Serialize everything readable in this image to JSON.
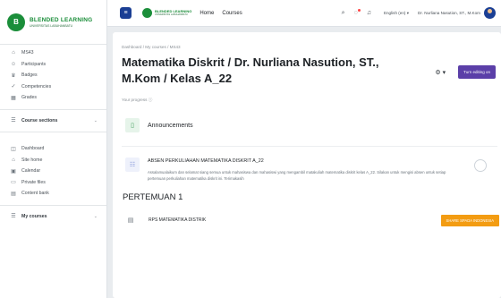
{
  "brand": {
    "logo_letter": "B",
    "name": "BLENDED LEARNING",
    "subtitle": "UNIVERSITAS LABUHANBATU"
  },
  "sidebar": {
    "items": [
      {
        "label": "MS43",
        "icon": "cap"
      },
      {
        "label": "Participants",
        "icon": "people"
      },
      {
        "label": "Badges",
        "icon": "badge"
      },
      {
        "label": "Competencies",
        "icon": "check"
      },
      {
        "label": "Grades",
        "icon": "table"
      }
    ],
    "course_sections": {
      "label": "Course sections",
      "icon": "list"
    },
    "links": [
      {
        "label": "Dashboard",
        "icon": "gauge"
      },
      {
        "label": "Site home",
        "icon": "home"
      },
      {
        "label": "Calendar",
        "icon": "calendar"
      },
      {
        "label": "Private files",
        "icon": "file"
      },
      {
        "label": "Content bank",
        "icon": "box"
      }
    ],
    "my_courses": {
      "label": "My courses",
      "icon": "cap"
    }
  },
  "topbar": {
    "menu_glyph": "≡",
    "logo_name": "BLENDED LEARNING",
    "logo_sub": "UNIVERSITAS LABUHANBATU",
    "links": [
      "Home",
      "Courses"
    ],
    "language": "English (en) ▾",
    "user_name": "Dr. Nurliana Nasution, ST., M.Kom"
  },
  "main": {
    "breadcrumb": "Dashboard  /  My courses  /  MS43",
    "title": "Matematika Diskrit / Dr. Nurliana Nasution, ST., M.Kom / Kelas A_22",
    "turn_editing_label": "Turn editing on",
    "progress_label": "Your progress ⓘ",
    "announcements_label": "Announcements",
    "absen_title": "ABSEN PERKULIAHAN MATEMATIKA DISKRIT A_22",
    "absen_desc": "Assalamualaikum dan selamat siang semua untuk mahasiswa dan mahasiswi yang mengambil matakuliah matematika diskrit kelas A_22. Silakan untuk mengisi absen untuk setiap pertemuan perkuliahan matematika diskrit ini. Terimakasih",
    "section_title": "PERTEMUAN 1",
    "rps_label": "RPS MATEMATIKA DISTRIK",
    "share_label": "SHARE SPADA INDONESIA"
  },
  "colors": {
    "brand_green": "#1b8e3a",
    "primary_blue": "#1b3f94",
    "edit_purple": "#5b3fa8",
    "share_orange": "#f39c12"
  }
}
